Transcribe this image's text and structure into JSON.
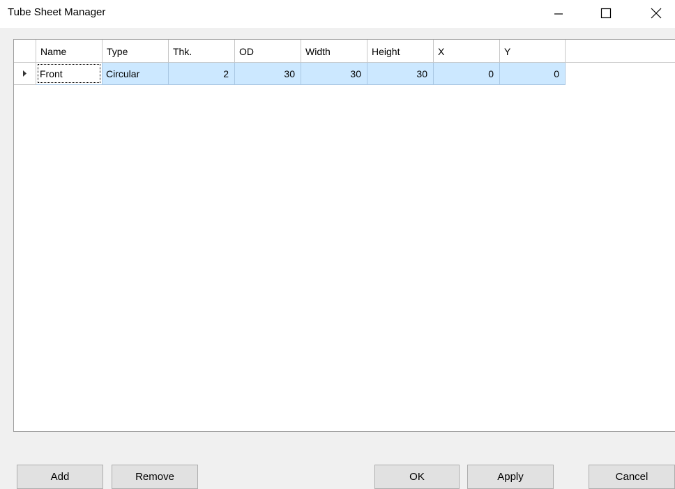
{
  "window": {
    "title": "Tube Sheet Manager"
  },
  "grid": {
    "columns": [
      "Name",
      "Type",
      "Thk.",
      "OD",
      "Width",
      "Height",
      "X",
      "Y"
    ],
    "rows": [
      {
        "name": "Front",
        "type": "Circular",
        "thk": "2",
        "od": "30",
        "width": "30",
        "height": "30",
        "x": "0",
        "y": "0"
      }
    ]
  },
  "buttons": {
    "add": "Add",
    "remove": "Remove",
    "ok": "OK",
    "apply": "Apply",
    "cancel": "Cancel"
  },
  "colors": {
    "selection": "#cce8ff",
    "window_bg": "#f0f0f0",
    "button_bg": "#e1e1e1"
  },
  "icons": {
    "minimize": "minimize-icon",
    "maximize": "maximize-icon",
    "close": "close-icon",
    "row_pointer": "row-pointer-icon"
  }
}
